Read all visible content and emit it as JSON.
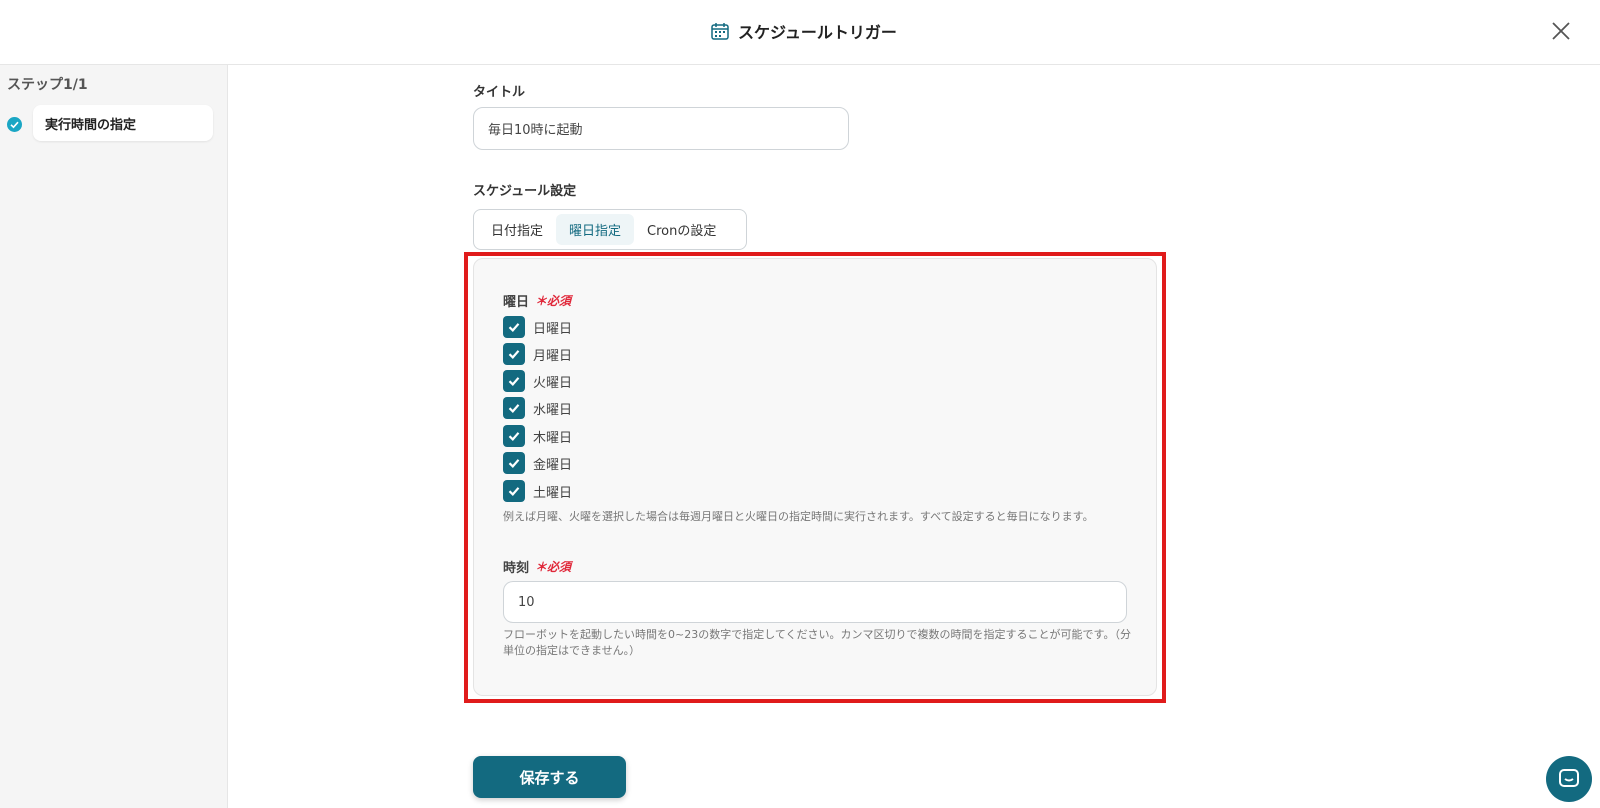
{
  "header": {
    "title": "スケジュールトリガー"
  },
  "sidebar": {
    "step_label": "ステップ1/1",
    "step_item": "実行時間の指定"
  },
  "title_field": {
    "label": "タイトル",
    "value": "毎日10時に起動"
  },
  "schedule": {
    "label": "スケジュール設定",
    "tabs": [
      "日付指定",
      "曜日指定",
      "Cronの設定"
    ],
    "active_tab": "曜日指定"
  },
  "weekday": {
    "label": "曜日",
    "required": "＊必須",
    "days": [
      "日曜日",
      "月曜日",
      "火曜日",
      "水曜日",
      "木曜日",
      "金曜日",
      "土曜日"
    ],
    "help": "例えば月曜、火曜を選択した場合は毎週月曜日と火曜日の指定時間に実行されます。すべて設定すると毎日になります。"
  },
  "time": {
    "label": "時刻",
    "required": "＊必須",
    "value": "10",
    "help_line1": "フローボットを起動したい時間を0~23の数字で指定してください。カンマ区切りで複数の時間を指定することが可能です。（分",
    "help_line2": "単位の指定はできません。）"
  },
  "save_label": "保存する",
  "colors": {
    "accent": "#136a80",
    "highlight": "#e01b1b",
    "required": "#e0283a",
    "step_check": "#1aa6c4"
  }
}
